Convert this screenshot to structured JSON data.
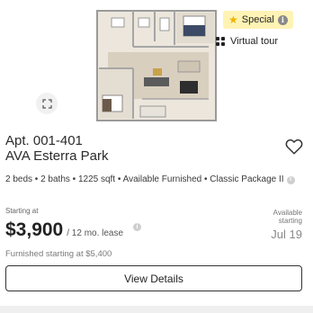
{
  "listing": {
    "special_label": "Special",
    "virtual_tour_label": "Virtual tour",
    "unit": "Apt. 001-401",
    "community": "AVA Esterra Park",
    "details": "2 beds • 2 baths • 1225 sqft • Available Furnished • Classic Package II",
    "starting_at_label": "Starting at",
    "price": "$3,900",
    "lease_term": "/ 12 mo. lease",
    "available_label": "Available starting",
    "available_date": "Jul 19",
    "furnished_text": "Furnished starting at $5,400",
    "view_details_label": "View Details"
  },
  "icons": {
    "expand": "expand-icon",
    "special_star": "star-icon",
    "info": "info-icon",
    "virtual_tour": "grid-icon",
    "favorite": "heart-icon"
  },
  "colors": {
    "special_badge_bg": "#fff3b5",
    "special_star": "#f0b400",
    "button_border": "#333333"
  }
}
